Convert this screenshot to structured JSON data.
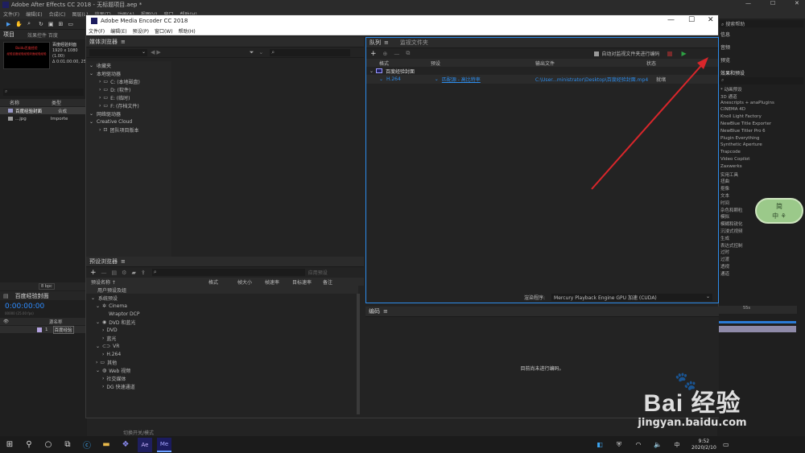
{
  "ae": {
    "title": "Adobe After Effects CC 2018 - 无标题项目.aep *",
    "menu": [
      "文件(F)",
      "编辑(E)",
      "合成(C)",
      "图层(L)",
      "效果(T)",
      "动画(A)",
      "视图(V)",
      "窗口",
      "帮助(H)"
    ],
    "project_tab": "项目",
    "effects_tab": "效果控件 百度",
    "comp_name": "百度经验封面",
    "comp_info1": "1920 x 1080 (1.00)",
    "comp_info2": "Δ 0:01:00:00, 25",
    "thumb_text1": "Baidu百度经验",
    "thumb_text2": "经验百度经验经验封面经验经验",
    "col_name": "名称",
    "col_type": "类型",
    "item1_name": "百度经验封面",
    "item1_type": "合成",
    "item2_name": "...jpg",
    "item2_type": "Importe",
    "bpc": "8 bpc",
    "timeline_tab": "百度经验封面",
    "timecode": "0:00:00:00",
    "timecode_sub": "00000 (25.00 fps)",
    "layer_col": "源名称",
    "layer_num": "1",
    "layer_name": "百度经验",
    "toggle_label": "切换开关/模式",
    "right_items": [
      "信息",
      "音频",
      "预览",
      "效果和预设"
    ],
    "search_help": "搜索帮助",
    "effects_list": [
      "* 动画预设",
      "3D 通道",
      "Anescripts + anaPlugins",
      "CINEMA 4D",
      "Knoll Light Factory",
      "NewBlue Title Exporter",
      "NewBlue Titler Pro 6",
      "Plugin Everything",
      "Synthetic Aperture",
      "Trapcode",
      "Video Copilot",
      "Zaxwerks",
      "实用工具",
      "扭曲",
      "抠像",
      "文本",
      "时间",
      "杂色和颗粒",
      "模拟",
      "模糊和锐化",
      "沉浸式视频",
      "生成",
      "表达式控制",
      "过时",
      "过渡",
      "透视",
      "通道"
    ],
    "timeline_time": "55s",
    "float_badge": "简\n中 ⚘"
  },
  "ame": {
    "title": "Adobe Media Encoder CC 2018",
    "menu": [
      "文件(F)",
      "编辑(E)",
      "预设(P)",
      "窗口(W)",
      "帮助(H)"
    ],
    "media_browser_tab": "媒体浏览器",
    "tree": [
      {
        "label": "收藏夹",
        "indent": 0
      },
      {
        "label": "本地驱动器",
        "indent": 0
      },
      {
        "label": "C: (本地磁盘)",
        "indent": 1
      },
      {
        "label": "D: (软件)",
        "indent": 1
      },
      {
        "label": "E: (临时)",
        "indent": 1
      },
      {
        "label": "F: (存档文件)",
        "indent": 1
      },
      {
        "label": "网络驱动器",
        "indent": 0
      },
      {
        "label": "Creative Cloud",
        "indent": 0
      },
      {
        "label": "团队项目版本",
        "indent": 1
      }
    ],
    "queue_tab": "队列",
    "watch_tab": "监视文件夹",
    "auto_encode_label": "自动对监视文件夹进行编码",
    "queue_cols": {
      "format": "格式",
      "preset": "预设",
      "output": "输出文件",
      "status": "状态"
    },
    "queue_group": "百度经验封面",
    "queue_item": {
      "format": "H.264",
      "preset": "匹配源 - 高比特率",
      "output": "C:\\User...ministrator\\Desktop\\百度经验封面.mp4",
      "status": "就绪"
    },
    "renderer_label": "渲染程序:",
    "renderer_value": "Mercury Playback Engine GPU 加速 (CUDA)",
    "preset_browser_tab": "预设浏览器",
    "apply_preset": "应用预设",
    "preset_cols": {
      "name": "预设名称 ↑",
      "format": "格式",
      "frame": "帧大小",
      "rate": "帧速率",
      "target": "目标速率",
      "note": "备注"
    },
    "preset_rows": [
      {
        "label": "用户预设及组",
        "indent": 0
      },
      {
        "label": "系统预设",
        "indent": 0
      },
      {
        "label": "Cinema",
        "indent": 1
      },
      {
        "label": "Wraptor DCP",
        "indent": 2
      },
      {
        "label": "DVD 和蓝光",
        "indent": 1
      },
      {
        "label": "DVD",
        "indent": 2
      },
      {
        "label": "蓝光",
        "indent": 2
      },
      {
        "label": "VR",
        "indent": 1
      },
      {
        "label": "H.264",
        "indent": 2
      },
      {
        "label": "其他",
        "indent": 1
      },
      {
        "label": "Web 视频",
        "indent": 1
      },
      {
        "label": "社交媒体",
        "indent": 2
      },
      {
        "label": "DG 快速通道",
        "indent": 2
      }
    ],
    "encoding_tab": "编码",
    "encoding_idle": "目前尚未进行编码。"
  },
  "taskbar": {
    "time": "9:52",
    "date": "2020/2/10",
    "lang": "中"
  },
  "watermark": {
    "brand": "Bai 经验",
    "url": "jingyan.baidu.com"
  },
  "colors": {
    "ame_accent": "#2d8ceb",
    "ae_blue": "#2b6fc2",
    "arrow": "#d9262b",
    "play": "#2ea043"
  }
}
